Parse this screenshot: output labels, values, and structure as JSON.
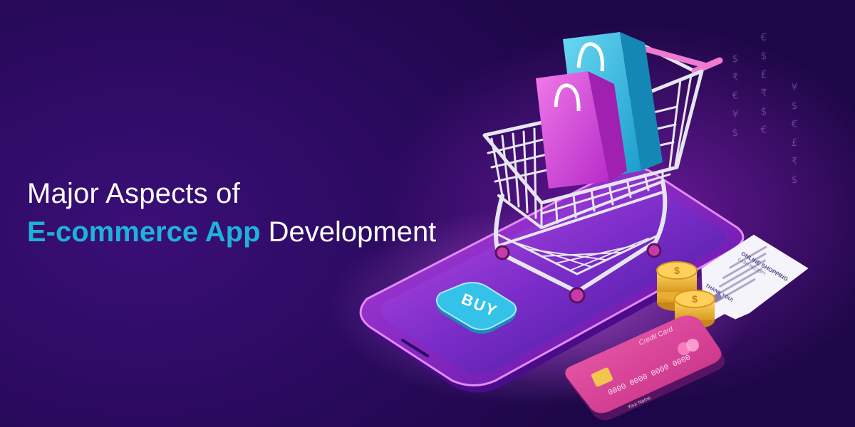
{
  "headline": {
    "line1": "Major Aspects of",
    "line2_accent": "E-commerce App",
    "line2_rest": " Development"
  },
  "phone": {
    "buy_button_label": "BUY"
  },
  "receipt": {
    "title": "ONLINE SHOPPING",
    "subtitle": "CASH RECEIPT",
    "thanks": "THANK YOU!"
  },
  "credit_card": {
    "label": "Credit Card",
    "number": "0000 0000 0000 0000",
    "holder": "Your Name"
  },
  "currency_symbols": {
    "col1": "$ ₹ € ¥ $",
    "col2": "€ $ £ ₹ $ €",
    "col3": "¥ $ € £ ₹ $"
  },
  "colors": {
    "background": "#2a0a5e",
    "accent_text": "#1fb2d8",
    "buy_button": "#2bb5de",
    "bag_pink": "#d63fd6",
    "bag_cyan": "#3ec6e6",
    "card_pink": "#e0459e"
  }
}
